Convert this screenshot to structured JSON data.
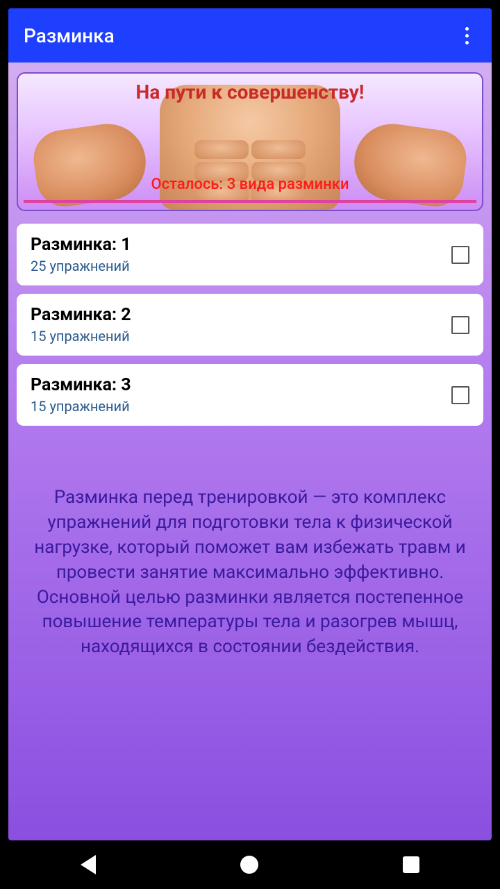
{
  "appbar": {
    "title": "Разминка"
  },
  "hero": {
    "title": "На пути к совершенству!",
    "subtitle": "Осталось: 3 вида разминки"
  },
  "warmups": [
    {
      "title": "Разминка: 1",
      "subtitle": "25 упражнений",
      "checked": false
    },
    {
      "title": "Разминка: 2",
      "subtitle": "15 упражнений",
      "checked": false
    },
    {
      "title": "Разминка: 3",
      "subtitle": "15 упражнений",
      "checked": false
    }
  ],
  "description": "Разминка перед тренировкой — это комплекс упражнений для подготовки тела к физической нагрузке, который поможет вам избежать травм и провести занятие максимально эффективно. Основной целью разминки является постепенное повышение температуры тела и разогрев мышц, находящихся в состоянии бездействия."
}
